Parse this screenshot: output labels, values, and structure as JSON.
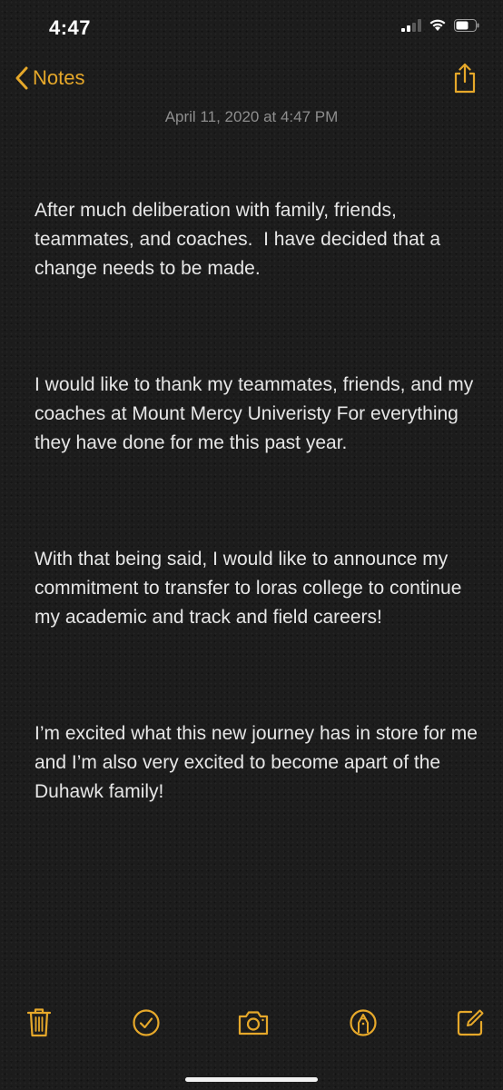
{
  "status_bar": {
    "time": "4:47",
    "icons": [
      "cellular-signal-icon",
      "wifi-icon",
      "battery-icon"
    ]
  },
  "nav": {
    "back_label": "Notes",
    "accent_color": "#e6a82a",
    "share_icon": "share-icon"
  },
  "note": {
    "date": "April 11, 2020 at 4:47 PM",
    "paragraphs": [
      "After much deliberation with family, friends, teammates, and coaches.  I have decided that a change needs to be made.",
      "I would like to thank my teammates, friends, and my coaches at Mount Mercy Univeristy For everything they have done for me this past year.",
      "With that being said, I would like to announce my commitment to transfer to loras college to continue my academic and track and field careers!",
      "I’m excited what this new journey has in store for me and I’m also very excited to become apart of the Duhawk family!"
    ]
  },
  "toolbar": {
    "icons": [
      "trash-icon",
      "checklist-icon",
      "camera-icon",
      "markup-pen-icon",
      "compose-icon"
    ]
  }
}
